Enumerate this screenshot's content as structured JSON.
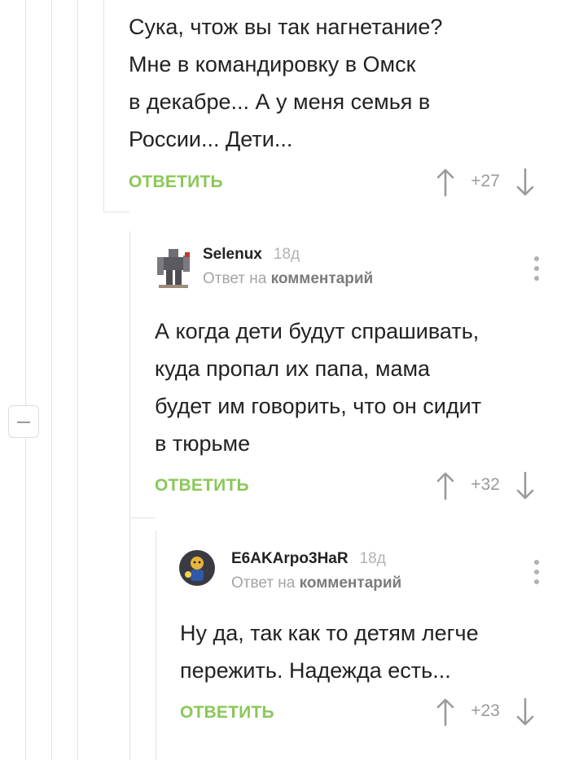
{
  "colors": {
    "accent": "#8ac858",
    "muted": "#9a9a9a",
    "text": "#222222"
  },
  "comments": [
    {
      "text": "Сука, чтож вы так нагнетание?\nМне в командировку в Омск\nв декабре... А у меня семья в\nРоссии... Дети...",
      "reply_label": "ОТВЕТИТЬ",
      "rating": "+27"
    },
    {
      "author": "Selenux",
      "time": "18д",
      "reply_prefix": "Ответ на",
      "reply_target": "комментарий",
      "avatar_icon": "robot-avatar-icon",
      "text": "А когда дети будут спрашивать,\nкуда пропал их папа, мама\nбудет им говорить, что он сидит\nв тюрьме",
      "reply_label": "ОТВЕТИТЬ",
      "rating": "+32"
    },
    {
      "author": "E6AKArpo3HaR",
      "time": "18д",
      "reply_prefix": "Ответ на",
      "reply_target": "комментарий",
      "avatar_icon": "character-avatar-icon",
      "text": "Ну да, так как то детям легче\nпережить. Надежда есть...",
      "reply_label": "ОТВЕТИТЬ",
      "rating": "+23"
    }
  ]
}
